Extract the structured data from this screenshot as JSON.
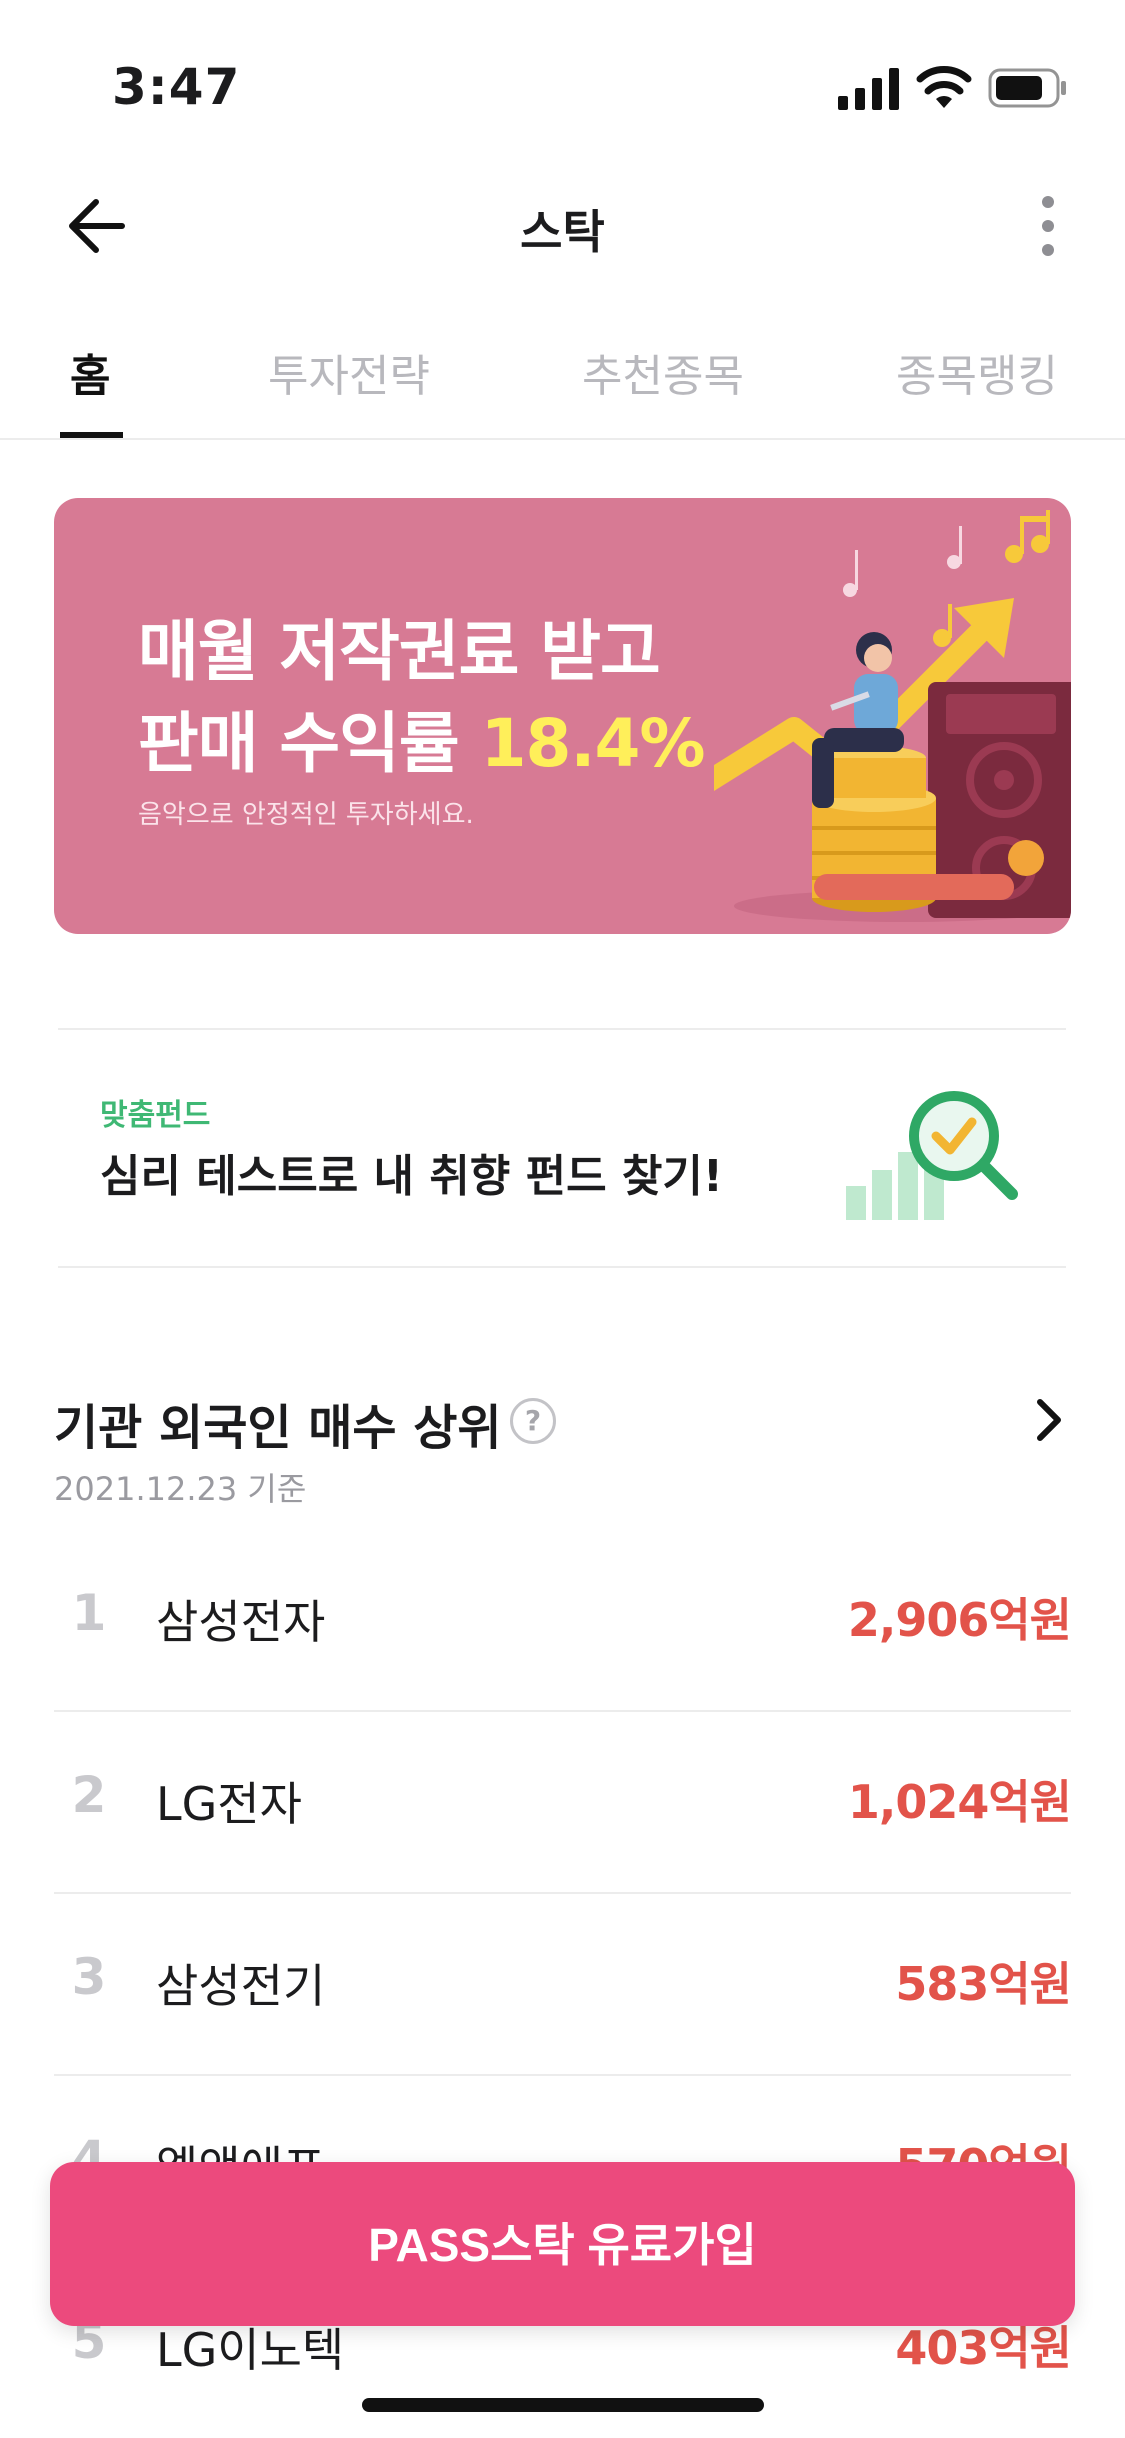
{
  "status_bar": {
    "time": "3:47"
  },
  "nav": {
    "title": "스탁"
  },
  "tabs": [
    {
      "label": "홈",
      "active": true
    },
    {
      "label": "투자전략",
      "active": false
    },
    {
      "label": "추천종목",
      "active": false
    },
    {
      "label": "종목랭킹",
      "active": false
    }
  ],
  "banner": {
    "line1": "매월 저작권료 받고",
    "line2_prefix": "판매 수익률 ",
    "line2_highlight": "18.4%",
    "subtitle": "음악으로 안정적인 투자하세요.",
    "background_color": "#d77a94",
    "highlight_color": "#ffef5a"
  },
  "fund_card": {
    "tag": "맞춤펀드",
    "title": "심리 테스트로 내 취향 펀드 찾기!",
    "tag_color": "#3fb874"
  },
  "ranking": {
    "title": "기관 외국인 매수 상위",
    "help_icon": "?",
    "date": "2021.12.23 기준",
    "amount_color": "#e2534a",
    "items": [
      {
        "rank": "1",
        "name": "삼성전자",
        "amount": "2,906억원"
      },
      {
        "rank": "2",
        "name": "LG전자",
        "amount": "1,024억원"
      },
      {
        "rank": "3",
        "name": "삼성전기",
        "amount": "583억원"
      },
      {
        "rank": "4",
        "name": "엘앤에프",
        "amount": "570억원"
      },
      {
        "rank": "5",
        "name": "LG이노텍",
        "amount": "403억원"
      }
    ]
  },
  "cta": {
    "label": "PASS스탁 유료가입",
    "color": "#ec4a7d"
  }
}
